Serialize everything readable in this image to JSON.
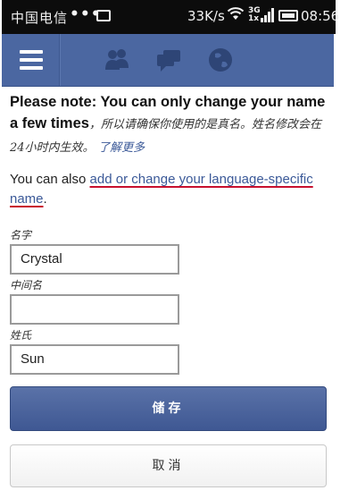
{
  "status_bar": {
    "carrier": "中国电信",
    "dots": "•••",
    "speed": "33K/s",
    "network_top": "3G",
    "network_bottom": "1x",
    "time": "08:56"
  },
  "header": {
    "menu_icon": "hamburger-menu-icon",
    "icons": [
      "friend-requests-icon",
      "messages-icon",
      "notifications-globe-icon"
    ],
    "background": "#4b67a1"
  },
  "notice": {
    "bold_text": "Please note: You can only change your name a few times",
    "chinese_text": "，所以请确保你使用的是真名。姓名修改会在24小时内生效。",
    "learn_more": "了解更多"
  },
  "language": {
    "prefix": "You can also ",
    "link": "add or change your language-specific name",
    "suffix": "."
  },
  "form": {
    "first_name_label": "名字",
    "first_name_value": "Crystal",
    "middle_name_label": "中间名",
    "middle_name_value": "",
    "last_name_label": "姓氏",
    "last_name_value": "Sun"
  },
  "buttons": {
    "save": "储存",
    "cancel": "取消"
  }
}
